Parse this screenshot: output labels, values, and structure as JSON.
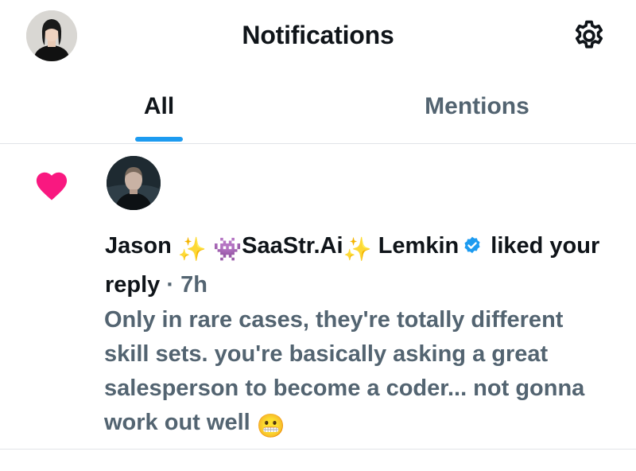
{
  "header": {
    "title": "Notifications",
    "avatar_icon": "user-avatar",
    "settings_icon": "gear-icon"
  },
  "tabs": [
    {
      "label": "All",
      "selected": true
    },
    {
      "label": "Mentions",
      "selected": false
    }
  ],
  "colors": {
    "accent": "#1d9bf0",
    "like": "#f91880",
    "secondary_text": "#536471",
    "primary_text": "#0f1419"
  },
  "notification": {
    "type_icon": "heart-icon",
    "actor": {
      "name_part1": "Jason",
      "name_emoji1": "✨",
      "name_emoji2": "👾",
      "name_part2": "SaaStr.Ai",
      "name_emoji3": "✨",
      "name_part3": "Lemkin",
      "verified": true
    },
    "action": "liked your reply",
    "separator": "·",
    "time": "7h",
    "text": "Only in rare cases, they're totally different skill sets. you're basically asking a great salesperson to become a coder... not gonna work out well",
    "text_emoji": "😬"
  }
}
